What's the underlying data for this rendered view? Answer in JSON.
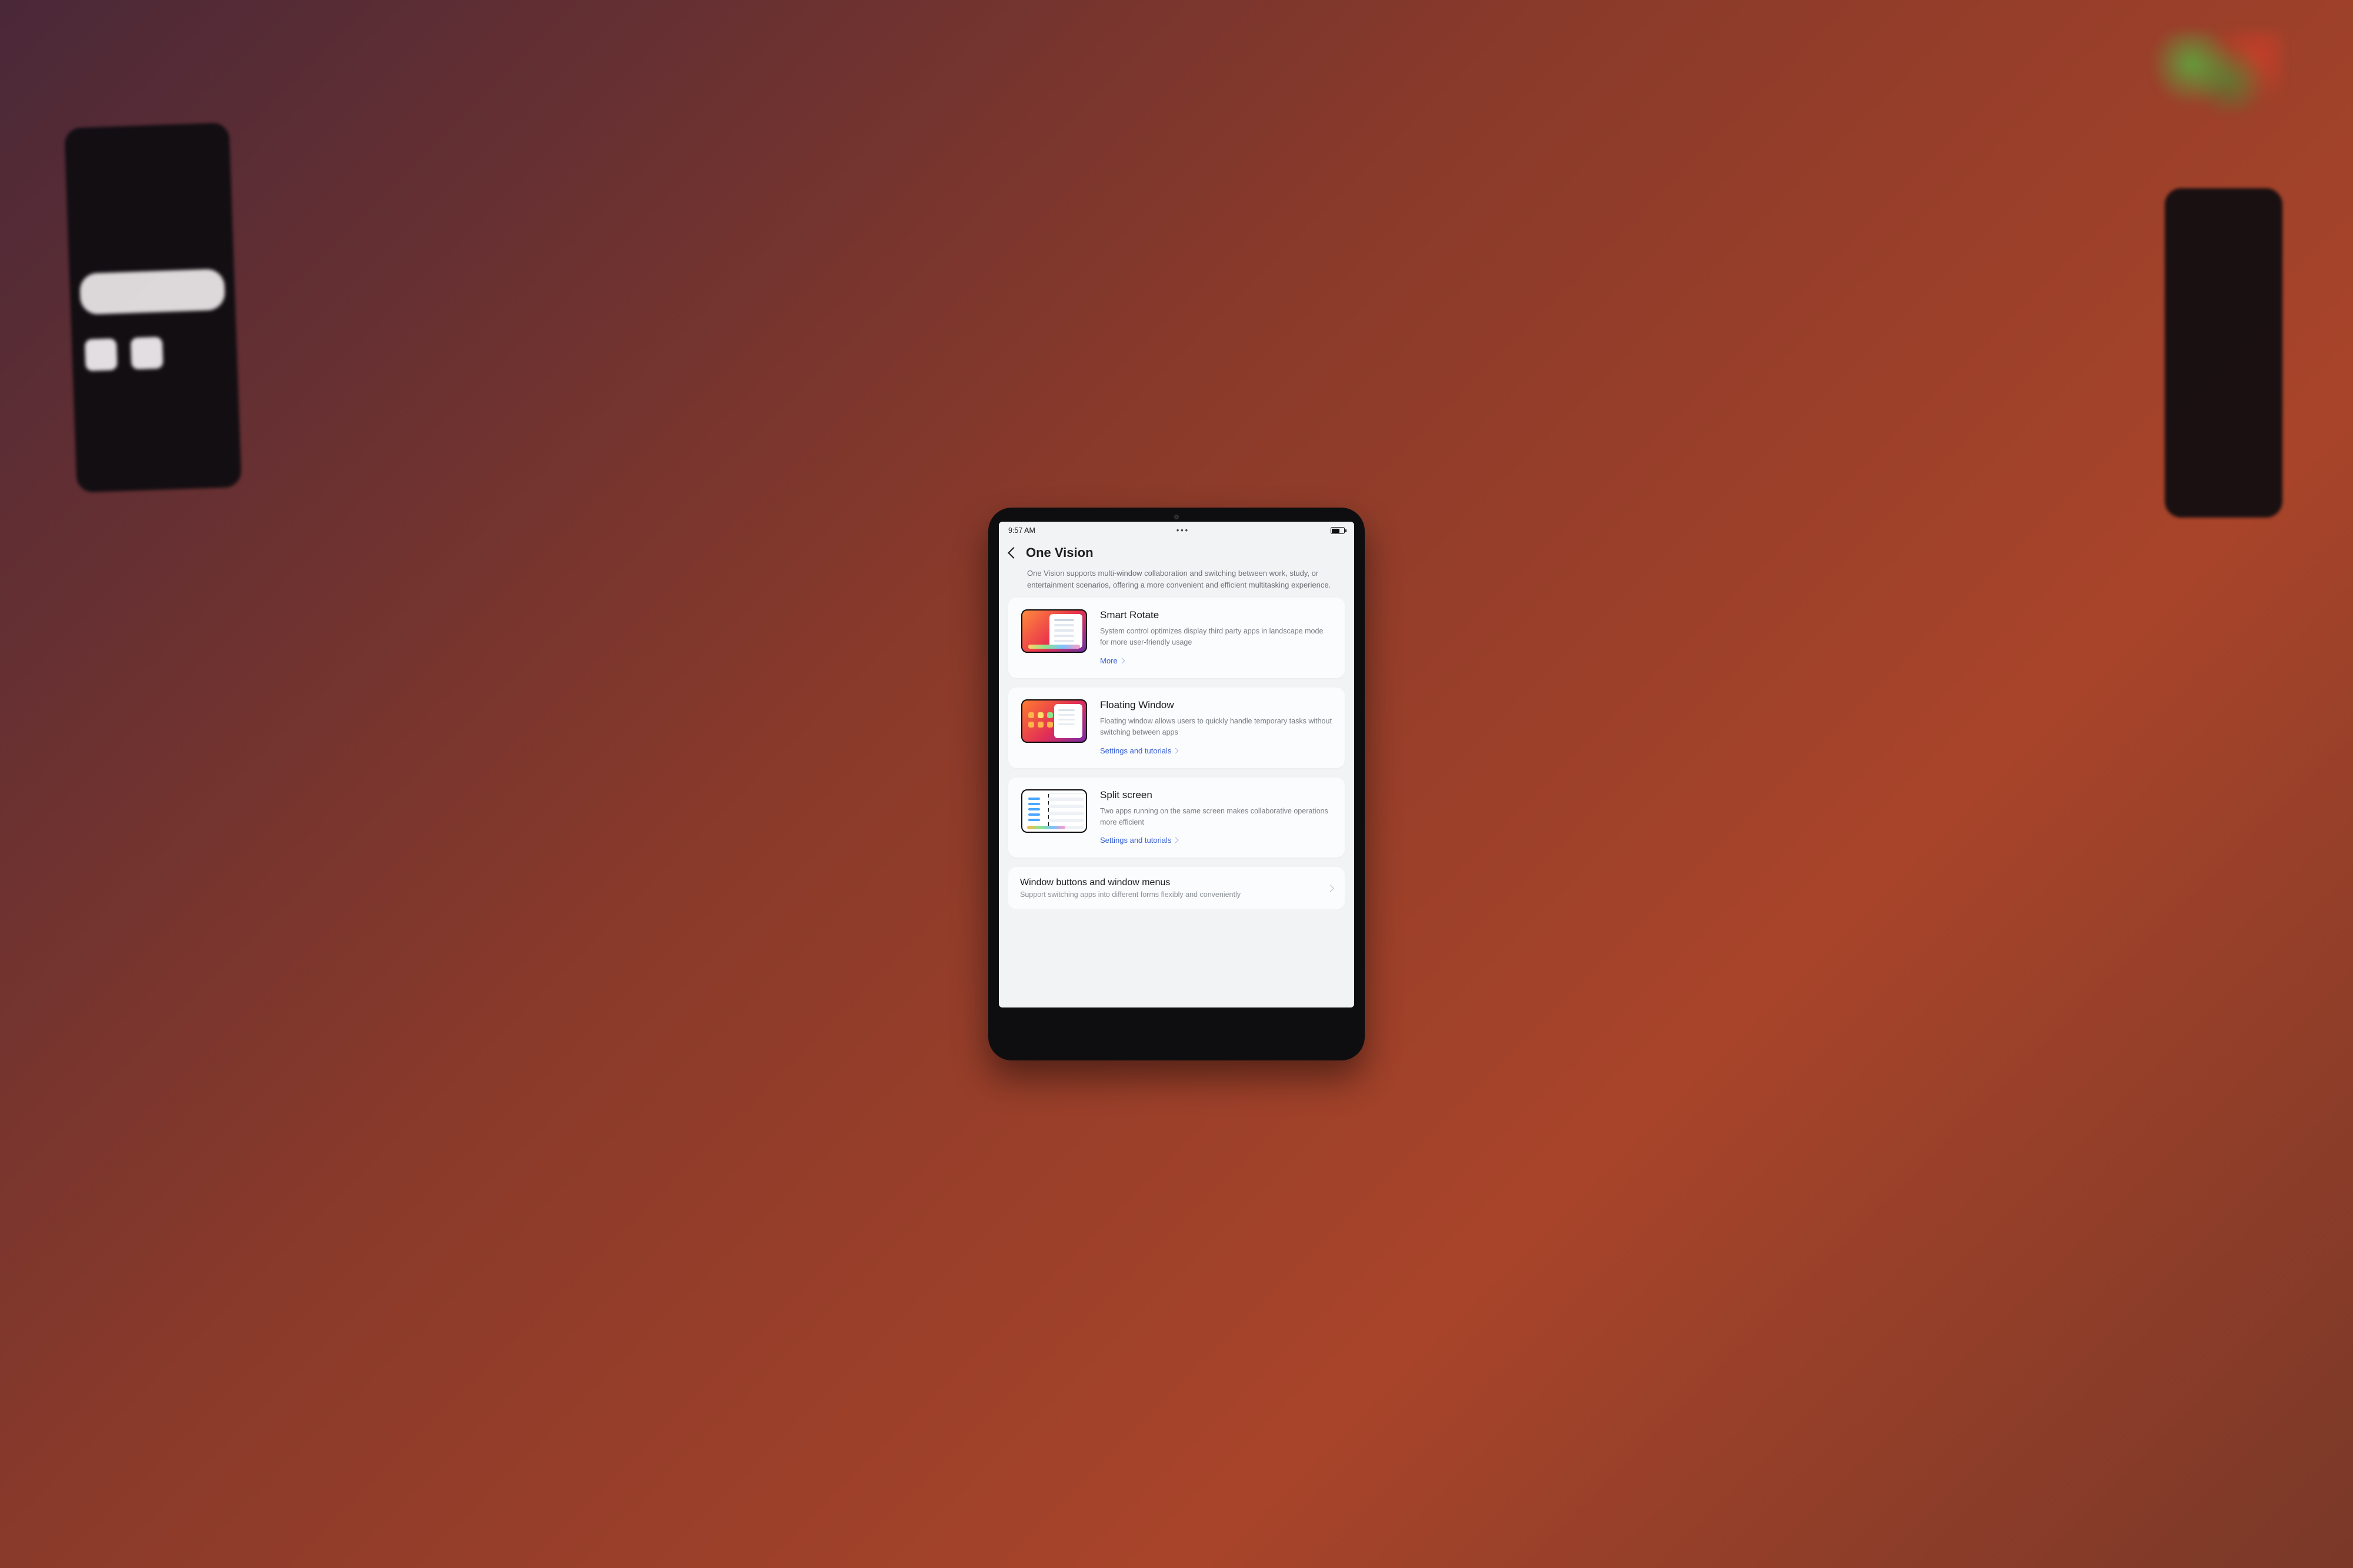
{
  "status": {
    "time": "9:57 AM"
  },
  "header": {
    "title": "One Vision"
  },
  "intro": "One Vision supports multi-window collaboration and switching between work, study, or entertainment scenarios, offering a more convenient and efficient multitasking experience.",
  "cards": [
    {
      "title": "Smart Rotate",
      "desc": "System control optimizes display third party apps in landscape mode for more user-friendly usage",
      "link": "More"
    },
    {
      "title": "Floating Window",
      "desc": "Floating window allows users to quickly handle temporary tasks without switching between apps",
      "link": "Settings and tutorials"
    },
    {
      "title": "Split screen",
      "desc": "Two apps running on the same screen makes collaborative operations more efficient",
      "link": "Settings and tutorials"
    }
  ],
  "row": {
    "title": "Window buttons and window menus",
    "subtitle": "Support switching apps into different forms flexibly and conveniently"
  }
}
